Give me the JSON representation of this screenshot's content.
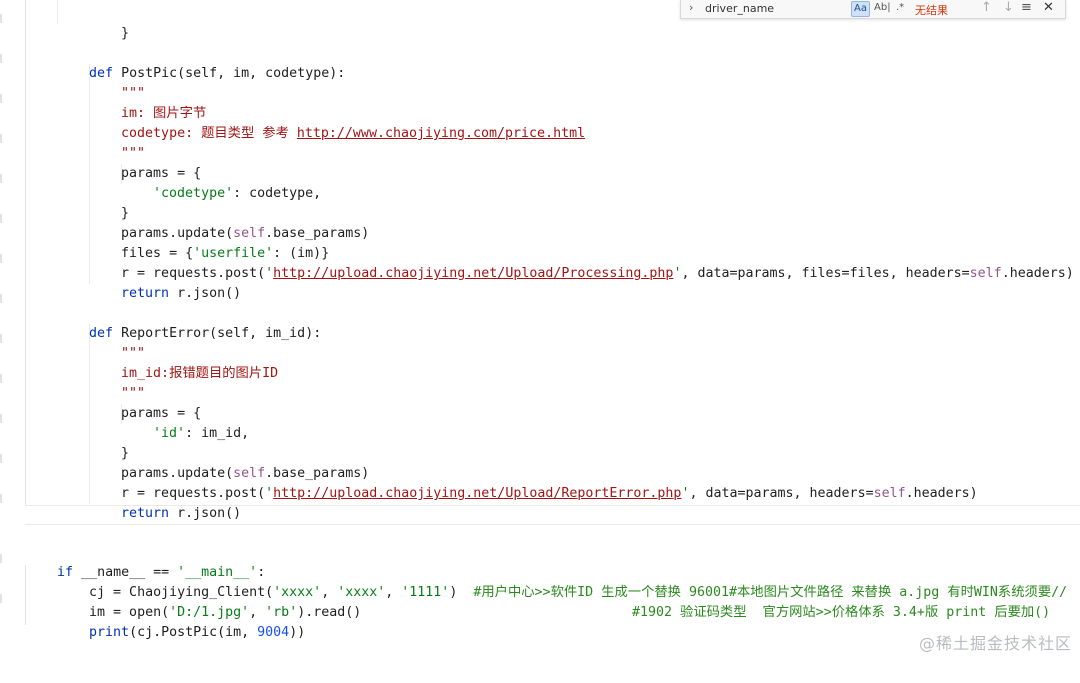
{
  "find": {
    "query": "driver_name",
    "match_case_label": "Aa",
    "whole_word_label": "Ab|",
    "regex_label": ".*",
    "result": "无结果"
  },
  "code": {
    "line0": "    }",
    "line1_def": "def",
    "line1_rest": " PostPic(self, im, codetype):",
    "line2": "\"\"\"",
    "line3": "im: 图片字节",
    "line4_pre": "codetype: 题目类型 参考 ",
    "line4_url": "http://www.chaojiying.com/price.html",
    "line5": "\"\"\"",
    "line6": "params = {",
    "line7_key": "'codetype'",
    "line7_rest": ": codetype,",
    "line8": "}",
    "line9_pre": "params.update(",
    "line9_self": "self",
    "line9_post": ".base_params)",
    "line10_pre": "files = {",
    "line10_key": "'userfile'",
    "line10_post": ": (im)}",
    "line11_pre": "r = requests.post(",
    "line11_q1": "'",
    "line11_url": "http://upload.chaojiying.net/Upload/Processing.php",
    "line11_q2": "'",
    "line11_mid": ", data=params, files=files, headers=",
    "line11_self": "self",
    "line11_post": ".headers)",
    "line12_kw": "return",
    "line12_rest": " r.json()",
    "line13_def": "def",
    "line13_rest": " ReportError(self, im_id):",
    "line14": "\"\"\"",
    "line15": "im_id:报错题目的图片ID",
    "line16": "\"\"\"",
    "line17": "params = {",
    "line18_key": "'id'",
    "line18_rest": ": im_id,",
    "line19": "}",
    "line20_pre": "params.update(",
    "line20_self": "self",
    "line20_post": ".base_params)",
    "line21_pre": "r = requests.post(",
    "line21_q1": "'",
    "line21_url": "http://upload.chaojiying.net/Upload/ReportError.php",
    "line21_q2": "'",
    "line21_mid": ", data=params, headers=",
    "line21_self": "self",
    "line21_post": ".headers)",
    "line22_kw": "return",
    "line22_rest": " r.json()",
    "line23_kw": "if",
    "line23_mid": " __name__ == ",
    "line23_str": "'__main__'",
    "line23_post": ":",
    "line24_pre": "cj = Chaojiying_Client(",
    "line24_s1": "'xxxx'",
    "line24_c1": ", ",
    "line24_s2": "'xxxx'",
    "line24_c2": ", ",
    "line24_s3": "'1111'",
    "line24_post": ")  ",
    "line24_cmt": "#用户中心>>软件ID 生成一个替换 96001",
    "line25_pre": "im = open(",
    "line25_s1": "'D:/1.jpg'",
    "line25_c1": ", ",
    "line25_s2": "'rb'",
    "line25_post": ").read()",
    "line25_cmt": "#本地图片文件路径 来替换 a.jpg 有时WIN系统须要//",
    "line26_kw": "print",
    "line26_mid": "(cj.PostPic(im, ",
    "line26_num": "9004",
    "line26_post": "))",
    "line26_cmt": "#1902 验证码类型  官方网站>>价格体系 3.4+版 print 后要加()"
  },
  "watermark": "@稀土掘金技术社区"
}
